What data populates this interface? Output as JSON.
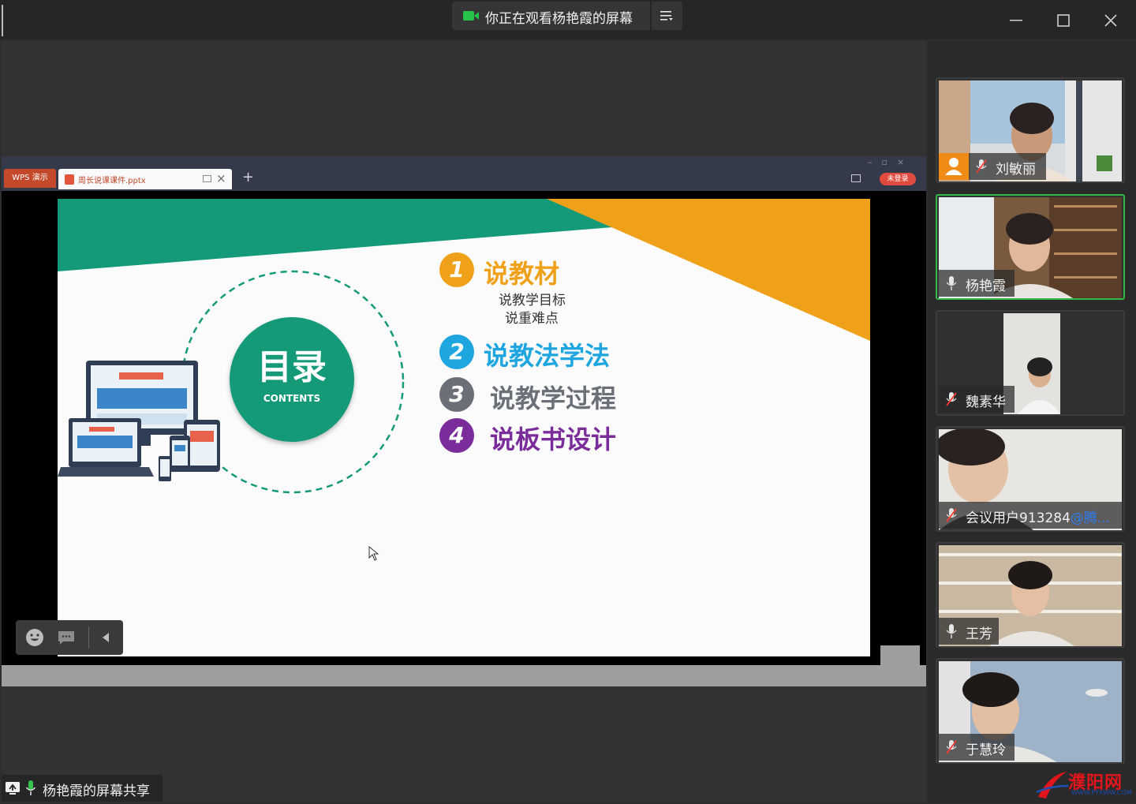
{
  "titlebar": {
    "watching_text": "你正在观看杨艳霞的屏幕"
  },
  "wps": {
    "app_tab": "WPS 演示",
    "file_tab": "周长说课课件.pptx",
    "login_badge": "未登录"
  },
  "slide": {
    "toc_title": "目录",
    "toc_subtitle": "CONTENTS",
    "items": [
      {
        "number": "1",
        "label": "说教材",
        "subs": [
          "说教学目标",
          "说重难点"
        ]
      },
      {
        "number": "2",
        "label": "说教法学法"
      },
      {
        "number": "3",
        "label": "说教学过程"
      },
      {
        "number": "4",
        "label": "说板书设计"
      }
    ],
    "colors": {
      "teal": "#149a78",
      "orange": "#f0a11a",
      "blue": "#1fa6e0",
      "gray": "#6a6f78",
      "purple": "#7a2d9a"
    }
  },
  "share_label": "杨艳霞的屏幕共享",
  "participants": [
    {
      "name": "刘敏丽",
      "muted": true,
      "host": true
    },
    {
      "name": "杨艳霞",
      "muted": false,
      "active": true
    },
    {
      "name": "魏素华",
      "muted": true
    },
    {
      "name": "会议用户913284",
      "name_extra": "@腾...",
      "muted": true
    },
    {
      "name": "王芳",
      "muted": false
    },
    {
      "name": "于慧玲",
      "muted": true
    }
  ],
  "watermark": {
    "name": "濮阳网",
    "url": "WWW.PYXWW.COM"
  }
}
